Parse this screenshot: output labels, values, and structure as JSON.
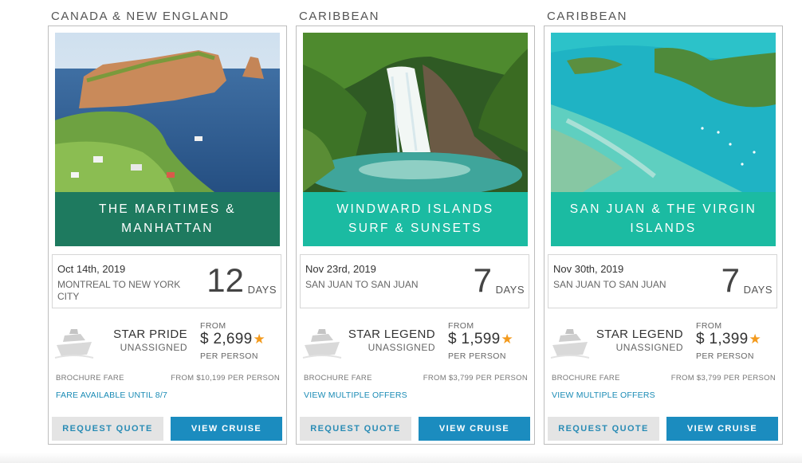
{
  "cards": [
    {
      "region": "CANADA & NEW ENGLAND",
      "title": "THE MARITIMES & MANHATTAN",
      "title_color": "#1e7a5f",
      "date": "Oct 14th, 2019",
      "route": "MONTREAL TO NEW YORK CITY",
      "days": "12",
      "days_label": "DAYS",
      "ship": "STAR PRIDE",
      "ship_status": "UNASSIGNED",
      "from_label": "FROM",
      "price": "$ 2,699",
      "per_person": "PER PERSON",
      "brochure_label": "BROCHURE FARE",
      "brochure_value": "FROM $10,199 PER PERSON",
      "offer_link": "FARE AVAILABLE UNTIL 8/7",
      "request_quote": "REQUEST QUOTE",
      "view_cruise": "VIEW CRUISE",
      "image_icon": "coastal-cliff-image"
    },
    {
      "region": "CARIBBEAN",
      "title": "WINDWARD ISLANDS SURF & SUNSETS",
      "title_color": "#1bbba2",
      "date": "Nov 23rd, 2019",
      "route": "SAN JUAN TO SAN JUAN",
      "days": "7",
      "days_label": "DAYS",
      "ship": "STAR LEGEND",
      "ship_status": "UNASSIGNED",
      "from_label": "FROM",
      "price": "$ 1,599",
      "per_person": "PER PERSON",
      "brochure_label": "BROCHURE FARE",
      "brochure_value": "FROM $3,799 PER PERSON",
      "offer_link": "VIEW MULTIPLE OFFERS",
      "request_quote": "REQUEST QUOTE",
      "view_cruise": "VIEW CRUISE",
      "image_icon": "waterfall-image"
    },
    {
      "region": "CARIBBEAN",
      "title": "SAN JUAN & THE VIRGIN ISLANDS",
      "title_color": "#1bbba2",
      "date": "Nov 30th, 2019",
      "route": "SAN JUAN TO SAN JUAN",
      "days": "7",
      "days_label": "DAYS",
      "ship": "STAR LEGEND",
      "ship_status": "UNASSIGNED",
      "from_label": "FROM",
      "price": "$ 1,399",
      "per_person": "PER PERSON",
      "brochure_label": "BROCHURE FARE",
      "brochure_value": "FROM $3,799 PER PERSON",
      "offer_link": "VIEW MULTIPLE OFFERS",
      "request_quote": "REQUEST QUOTE",
      "view_cruise": "VIEW CRUISE",
      "image_icon": "island-lagoon-image"
    }
  ],
  "colors": {
    "accent_blue": "#1b8cbf",
    "star_orange": "#f39a1d",
    "link_blue": "#1a8bb5"
  },
  "icons": {
    "ship": "ship-icon",
    "star": "star-icon"
  }
}
